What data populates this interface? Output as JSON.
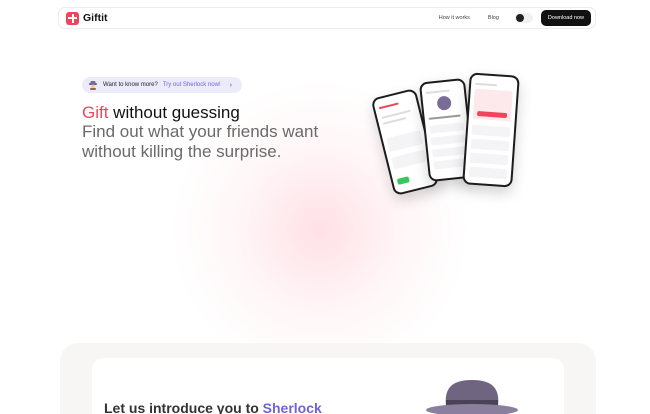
{
  "nav": {
    "logo_text": "Giftit",
    "links": [
      "How it works",
      "Blog"
    ],
    "download_label": "Download now"
  },
  "pill": {
    "text": "Want to know more?",
    "link": "Try out Sherlock now!",
    "arrow": "›"
  },
  "hero": {
    "title_accent": "Gift",
    "title_rest": " without guessing",
    "subtitle": "Find out what your friends want without killing the surprise."
  },
  "section2": {
    "title_prefix": "Let us introduce you to ",
    "title_accent": "Sherlock"
  },
  "colors": {
    "brand_red": "#f0445c",
    "accent_purple": "#6f64d6",
    "dark": "#111111"
  },
  "icons": [
    "giftit-logo-icon",
    "sherlock-avatar-icon",
    "chevron-right-icon",
    "theme-toggle-icon",
    "detective-hat-icon"
  ]
}
